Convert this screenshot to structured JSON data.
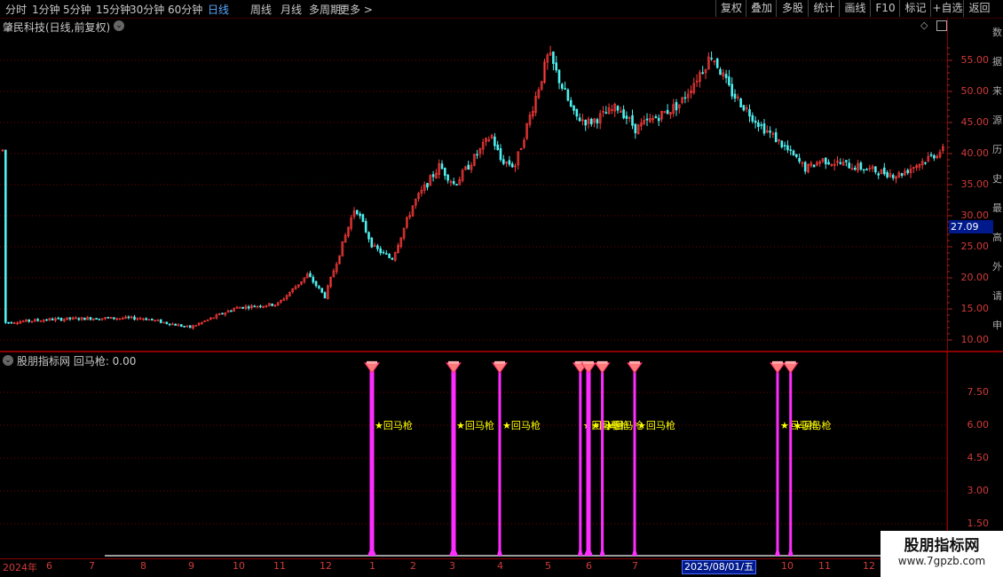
{
  "toolbar": {
    "periods": [
      "分时",
      "1分钟",
      "5分钟",
      "15分钟",
      "30分钟",
      "60分钟",
      "日线",
      "周线",
      "月线",
      "多周期",
      "更多 >"
    ],
    "active_period": "日线",
    "buttons": [
      "复权",
      "叠加",
      "多股",
      "统计",
      "画线",
      "F10",
      "标记",
      "+自选",
      "返回"
    ]
  },
  "chart_header": {
    "stock_title": "肇民科技(日线,前复权)",
    "latest_price_tag": "27.09"
  },
  "price_axis": {
    "ticks": [
      "55.00",
      "50.00",
      "45.00",
      "40.00",
      "35.00",
      "30.00",
      "25.00",
      "20.00",
      "15.00",
      "10.00"
    ]
  },
  "indicator": {
    "title": "股朋指标网 回马枪: 0.00",
    "signal_label": "★回马枪",
    "axis_ticks": [
      "7.50",
      "6.00",
      "4.50",
      "3.00",
      "1.50"
    ]
  },
  "time_axis": {
    "labels": [
      "2024年",
      "6",
      "7",
      "8",
      "9",
      "10",
      "11",
      "12",
      "1",
      "2",
      "3",
      "4",
      "5",
      "6",
      "7",
      "10",
      "11",
      "12"
    ],
    "cursor_date": "2025/08/01/五"
  },
  "side_glyphs": [
    "数",
    "据",
    "来",
    "源",
    "历",
    "史",
    "最",
    "高",
    "外",
    "请",
    "申"
  ],
  "watermark": {
    "line1": "股朋指标网",
    "line2": "www.7gpzb.com"
  },
  "colors": {
    "up": "#ff3b3b",
    "down": "#4ff0f0",
    "signal_bar": "#ff2cff",
    "signal_text": "#ffff00",
    "grid": "#7a0000",
    "axis_label": "#d23a3a",
    "highlight": "#001a8c"
  },
  "chart_data": {
    "type": "candlestick",
    "title": "肇民科技(日线,前复权)",
    "x_range": [
      "2024-05",
      "2025-12"
    ],
    "y_range": [
      10,
      58
    ],
    "key_prices": {
      "min_approx": 11.0,
      "max_approx": 58.5,
      "latest_tag": 27.09
    },
    "price_path": [
      [
        "2024-05",
        12.8
      ],
      [
        "2024-06",
        13.3
      ],
      [
        "2024-07",
        13.5
      ],
      [
        "2024-08",
        13.5
      ],
      [
        "2024-09",
        12.0
      ],
      [
        "2024-10",
        15.2
      ],
      [
        "2024-11",
        15.8
      ],
      [
        "2024-11-20",
        20.5
      ],
      [
        "2024-12",
        17.0
      ],
      [
        "2024-12-20",
        31.5
      ],
      [
        "2025-01",
        25.0
      ],
      [
        "2025-01-15",
        23.0
      ],
      [
        "2025-02",
        32.0
      ],
      [
        "2025-02-20",
        38.0
      ],
      [
        "2025-03",
        35.0
      ],
      [
        "2025-03-25",
        43.0
      ],
      [
        "2025-04",
        39.0
      ],
      [
        "2025-04-10",
        38.0
      ],
      [
        "2025-05",
        56.0
      ],
      [
        "2025-05-20",
        46.0
      ],
      [
        "2025-06",
        45.0
      ],
      [
        "2025-06-20",
        47.5
      ],
      [
        "2025-07",
        44.0
      ],
      [
        "2025-07-20",
        46.5
      ],
      [
        "2025-08",
        48.0
      ],
      [
        "2025-08-20",
        56.0
      ],
      [
        "2025-09",
        50.0
      ],
      [
        "2025-09-20",
        44.5
      ],
      [
        "2025-10",
        42.0
      ],
      [
        "2025-10-20",
        37.5
      ],
      [
        "2025-11",
        39.0
      ],
      [
        "2025-11-20",
        36.5
      ],
      [
        "2025-12",
        40.5
      ]
    ],
    "indicator_series": {
      "name": "回马枪",
      "current_value": 0.0,
      "signal_value": 8.6,
      "signal_dates": [
        "2025-01",
        "2025-03",
        "2025-04",
        "2025-05-25",
        "2025-06-01",
        "2025-06-10",
        "2025-07",
        "2025-10-01",
        "2025-10-10"
      ]
    }
  }
}
